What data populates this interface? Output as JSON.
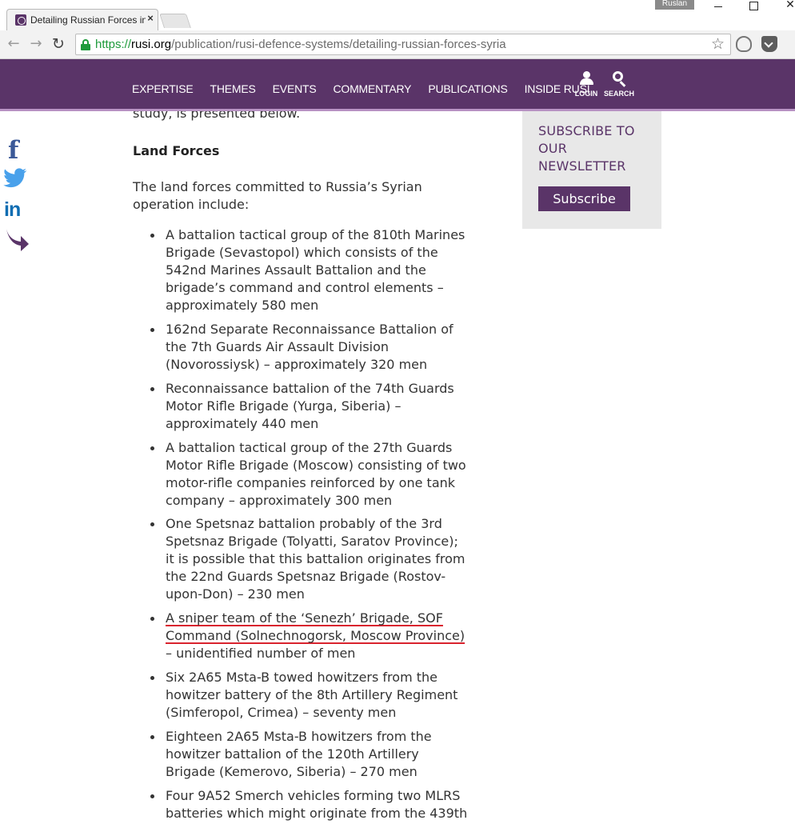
{
  "browser": {
    "tab_title": "Detailing Russian Forces in Syria",
    "tab_close": "×",
    "profile_name": "Ruslan",
    "url_scheme": "https://",
    "url_host": "rusi.org",
    "url_path": "/publication/rusi-defence-systems/detailing-russian-forces-syria",
    "icons": {
      "back": "arrow-left-icon",
      "forward": "arrow-right-icon",
      "reload": "reload-icon",
      "secure": "lock-icon",
      "bookmark": "star-icon",
      "extension_1": "ghostery-icon",
      "extension_2": "pocket-icon"
    }
  },
  "site": {
    "brand_color": "#5a3468",
    "nav": [
      "EXPERTISE",
      "THEMES",
      "EVENTS",
      "COMMENTARY",
      "PUBLICATIONS",
      "INSIDE RUSI"
    ],
    "login_label": "LOGIN",
    "search_label": "SEARCH"
  },
  "share": {
    "icons": [
      "facebook-icon",
      "twitter-icon",
      "linkedin-icon",
      "share-forward-icon"
    ]
  },
  "article": {
    "clipped_text": "study, is presented below.",
    "section_heading": "Land Forces",
    "intro": "The land forces committed to Russia’s Syrian operation include:",
    "items": [
      "A battalion tactical group of the 810th Marines Brigade (Sevastopol) which consists of the 542nd Marines Assault Battalion and the brigade’s command and control elements – approximately 580 men",
      "162nd Separate Reconnaissance Battalion of the 7th Guards Air Assault Division (Novorossiysk) – approximately 320 men",
      "Reconnaissance battalion of the 74th Guards Motor Rifle Brigade (Yurga, Siberia) – approximately 440 men",
      "A battalion tactical group of the 27th Guards Motor Rifle Brigade (Moscow) consisting of two motor-rifle companies reinforced by one tank company – approximately 300 men",
      "One Spetsnaz battalion probably of the 3rd Spetsnaz Brigade (Tolyatti, Saratov Province); it is possible that this battalion originates from the 22nd Guards Spetsnaz Brigade (Rostov-upon-Don) – 230 men",
      "",
      "Six 2A65 Msta-B towed howitzers from the howitzer battery of the 8th Artillery Regiment (Simferopol, Crimea) – seventy men",
      "Eighteen 2A65 Msta-B howitzers from the howitzer battalion of the 120th Artillery Brigade (Kemerovo, Siberia) – 270 men",
      "Four 9A52 Smerch vehicles forming two MLRS batteries which might originate from the 439th"
    ],
    "sniper_item": {
      "underlined": "A sniper team of the ‘Senezh’ Brigade, SOF Command (Solnechnogorsk, Moscow Province)",
      "rest": " – unidentified number of men",
      "underline_color": "#d9232e"
    }
  },
  "sidebar": {
    "newsletter_title": "SUBSCRIBE TO OUR NEWSLETTER",
    "subscribe_label": "Subscribe"
  }
}
